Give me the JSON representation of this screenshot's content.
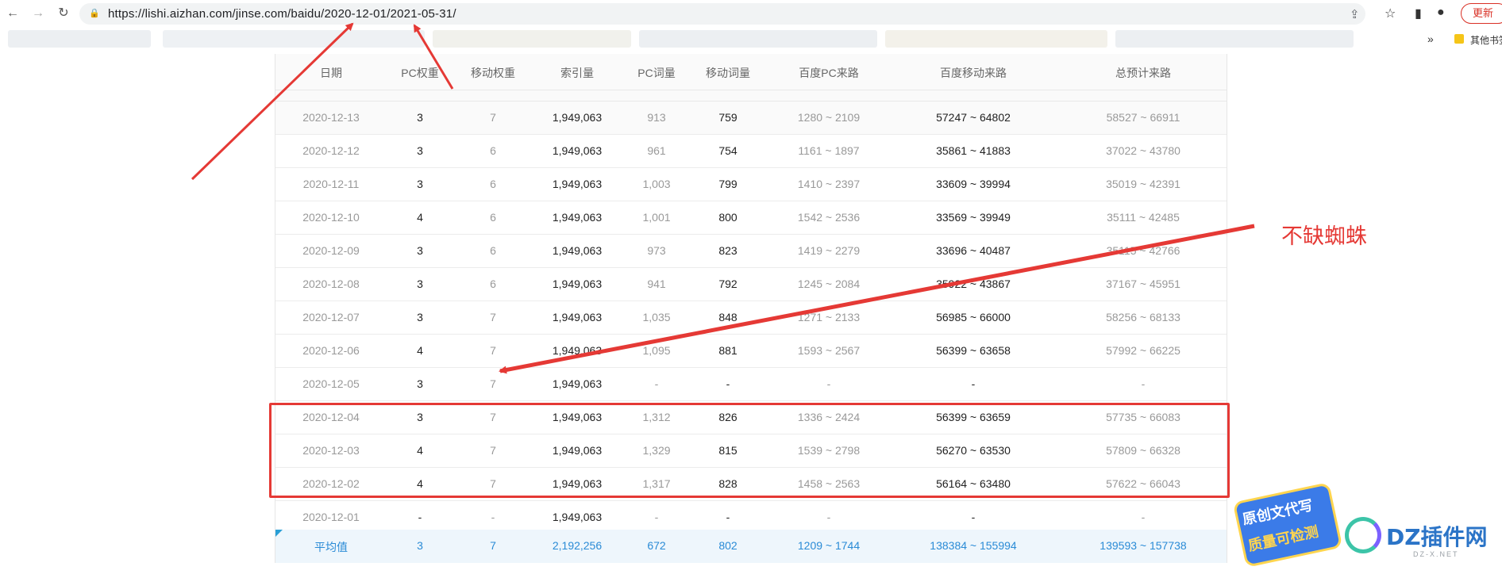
{
  "browser": {
    "url": "https://lishi.aizhan.com/jinse.com/baidu/2020-12-01/2021-05-31/",
    "update_label": "更新",
    "bookmarks_more": "»",
    "other_bookmarks": "其他书签"
  },
  "table": {
    "headers": [
      "日期",
      "PC权重",
      "移动权重",
      "索引量",
      "PC词量",
      "移动词量",
      "百度PC来路",
      "百度移动来路",
      "总预计来路"
    ],
    "rows": [
      [
        "2020-12-13",
        "3",
        "7",
        "1,949,063",
        "913",
        "759",
        "1280 ~ 2109",
        "57247 ~ 64802",
        "58527 ~ 66911"
      ],
      [
        "2020-12-12",
        "3",
        "6",
        "1,949,063",
        "961",
        "754",
        "1161 ~ 1897",
        "35861 ~ 41883",
        "37022 ~ 43780"
      ],
      [
        "2020-12-11",
        "3",
        "6",
        "1,949,063",
        "1,003",
        "799",
        "1410 ~ 2397",
        "33609 ~ 39994",
        "35019 ~ 42391"
      ],
      [
        "2020-12-10",
        "4",
        "6",
        "1,949,063",
        "1,001",
        "800",
        "1542 ~ 2536",
        "33569 ~ 39949",
        "35111 ~ 42485"
      ],
      [
        "2020-12-09",
        "3",
        "6",
        "1,949,063",
        "973",
        "823",
        "1419 ~ 2279",
        "33696 ~ 40487",
        "35115 ~ 42766"
      ],
      [
        "2020-12-08",
        "3",
        "6",
        "1,949,063",
        "941",
        "792",
        "1245 ~ 2084",
        "35922 ~ 43867",
        "37167 ~ 45951"
      ],
      [
        "2020-12-07",
        "3",
        "7",
        "1,949,063",
        "1,035",
        "848",
        "1271 ~ 2133",
        "56985 ~ 66000",
        "58256 ~ 68133"
      ],
      [
        "2020-12-06",
        "4",
        "7",
        "1,949,063",
        "1,095",
        "881",
        "1593 ~ 2567",
        "56399 ~ 63658",
        "57992 ~ 66225"
      ],
      [
        "2020-12-05",
        "3",
        "7",
        "1,949,063",
        "-",
        "-",
        "-",
        "-",
        "-"
      ],
      [
        "2020-12-04",
        "3",
        "7",
        "1,949,063",
        "1,312",
        "826",
        "1336 ~ 2424",
        "56399 ~ 63659",
        "57735 ~ 66083"
      ],
      [
        "2020-12-03",
        "4",
        "7",
        "1,949,063",
        "1,329",
        "815",
        "1539 ~ 2798",
        "56270 ~ 63530",
        "57809 ~ 66328"
      ],
      [
        "2020-12-02",
        "4",
        "7",
        "1,949,063",
        "1,317",
        "828",
        "1458 ~ 2563",
        "56164 ~ 63480",
        "57622 ~ 66043"
      ],
      [
        "2020-12-01",
        "-",
        "-",
        "1,949,063",
        "-",
        "-",
        "-",
        "-",
        "-"
      ]
    ],
    "average": [
      "平均值",
      "3",
      "7",
      "2,192,256",
      "672",
      "802",
      "1209 ~ 1744",
      "138384 ~ 155994",
      "139593 ~ 157738"
    ]
  },
  "annotation": {
    "text": "不缺蜘蛛",
    "color": "#e53935"
  },
  "watermarks": {
    "badge_line1": "原创文代写",
    "badge_line2": "质量可检测",
    "site_logo": "DZ插件网",
    "site_sub": "DZ-X.NET"
  },
  "colors": {
    "accent_blue": "#2a8bd6",
    "annotation_red": "#e53935",
    "muted_text": "#999999"
  }
}
